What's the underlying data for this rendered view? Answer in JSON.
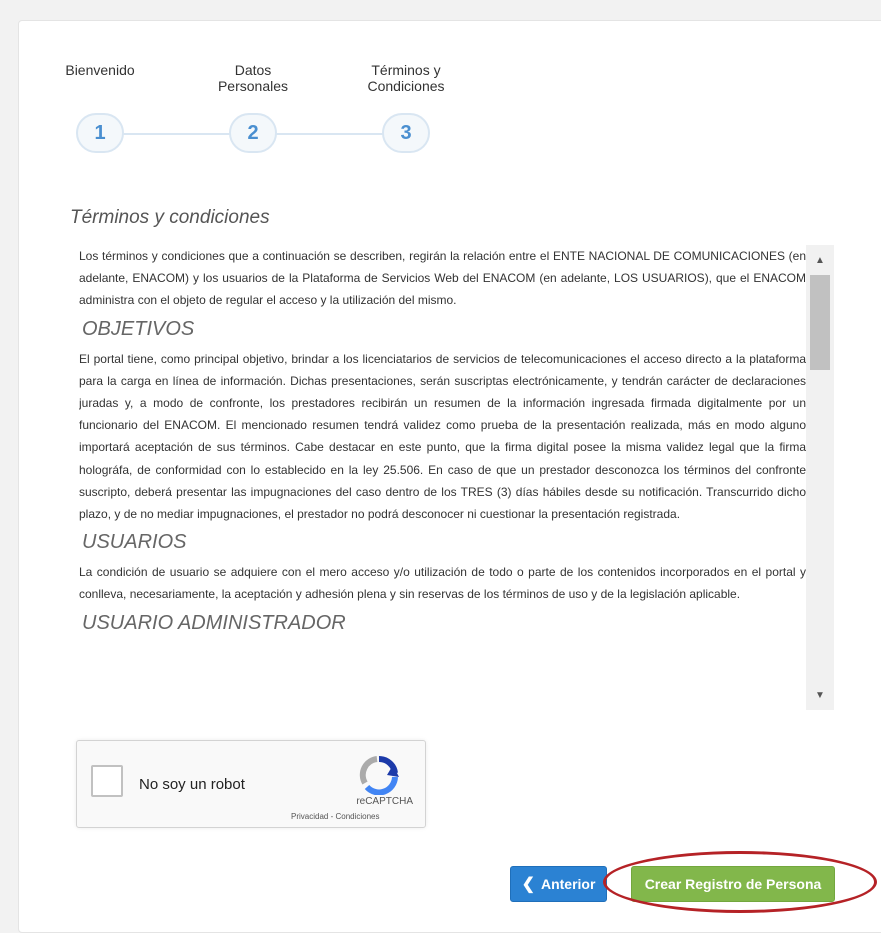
{
  "wizard": {
    "steps": [
      {
        "label": "Bienvenido",
        "number": "1"
      },
      {
        "label": "Datos Personales",
        "number": "2"
      },
      {
        "label": "Términos y Condiciones",
        "number": "3"
      }
    ]
  },
  "terms": {
    "title": "Términos y condiciones",
    "intro": "Los términos y condiciones que a continuación se describen, regirán la relación entre el ENTE NACIONAL DE COMUNICACIONES (en adelante, ENACOM) y los usuarios de la Plataforma de Servicios Web del ENACOM (en adelante, LOS USUARIOS), que el ENACOM administra con el objeto de regular el acceso y la utilización del mismo.",
    "sections": [
      {
        "heading": "OBJETIVOS",
        "body": "El portal tiene, como principal objetivo, brindar a los licenciatarios de servicios de telecomunicaciones el acceso directo a la plataforma para la carga en línea de información. Dichas presentaciones, serán suscriptas electrónicamente, y tendrán carácter de declaraciones juradas y, a modo de confronte, los prestadores recibirán un resumen de la información ingresada firmada digitalmente por un funcionario del ENACOM. El mencionado resumen tendrá validez como prueba de la presentación realizada, más en modo alguno importará aceptación de sus términos. Cabe destacar en este punto, que la firma digital posee la misma validez legal que la firma holográfa, de conformidad con lo establecido en la ley 25.506. En caso de que un prestador desconozca los términos del confronte suscripto, deberá presentar las impugnaciones del caso dentro de los TRES (3) días hábiles desde su notificación. Transcurrido dicho plazo, y de no mediar impugnaciones, el prestador no podrá desconocer ni cuestionar la presentación registrada."
      },
      {
        "heading": "USUARIOS",
        "body": "La condición de usuario se adquiere con el mero acceso y/o utilización de todo o parte de los contenidos incorporados en el portal y conlleva, necesariamente, la aceptación y adhesión plena y sin reservas de los términos de uso y de la legislación aplicable."
      },
      {
        "heading": "USUARIO ADMINISTRADOR",
        "body": ""
      }
    ]
  },
  "captcha": {
    "label": "No soy un robot",
    "brand": "reCAPTCHA",
    "links": "Privacidad - Condiciones"
  },
  "buttons": {
    "previous": "Anterior",
    "create": "Crear Registro de Persona"
  },
  "colors": {
    "step_accent": "#4a8fd0",
    "previous_button": "#2b82d3",
    "create_button": "#82b74b",
    "highlight": "#b52226"
  }
}
